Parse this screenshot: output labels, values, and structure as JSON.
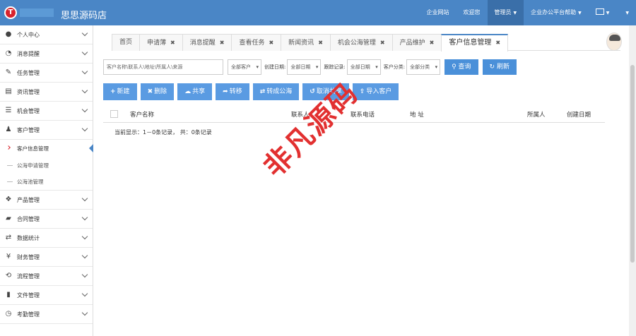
{
  "app": {
    "logo_letter": "T",
    "title": "思思源码店"
  },
  "topnav": {
    "items": [
      "企业网站",
      "欢迎您",
      "管理员",
      "企业办公平台帮助"
    ],
    "active_index": 2
  },
  "sidebar": {
    "items": [
      {
        "label": "个人中心",
        "icon": "user-icon"
      },
      {
        "label": "消息提醒",
        "icon": "bell-icon"
      },
      {
        "label": "任务管理",
        "icon": "edit-icon"
      },
      {
        "label": "资讯管理",
        "icon": "document-icon"
      },
      {
        "label": "机会管理",
        "icon": "list-icon"
      },
      {
        "label": "客户管理",
        "icon": "users-icon"
      },
      {
        "label": "产品管理",
        "icon": "box-icon"
      },
      {
        "label": "合同管理",
        "icon": "folder-icon"
      },
      {
        "label": "数据统计",
        "icon": "shuffle-icon"
      },
      {
        "label": "财务管理",
        "icon": "yen-icon"
      },
      {
        "label": "流程管理",
        "icon": "retweet-icon"
      },
      {
        "label": "文件管理",
        "icon": "file-icon"
      },
      {
        "label": "考勤管理",
        "icon": "clock-icon"
      }
    ],
    "subitems": [
      "客户信息管理",
      "公海申请管理",
      "公海池管理"
    ],
    "active_sub": "客户信息管理"
  },
  "tabs": [
    {
      "label": "首页",
      "closable": false
    },
    {
      "label": "申请薄",
      "closable": true
    },
    {
      "label": "消息提醒",
      "closable": true
    },
    {
      "label": "查看任务",
      "closable": true
    },
    {
      "label": "新闻资讯",
      "closable": true
    },
    {
      "label": "机会公海管理",
      "closable": true
    },
    {
      "label": "产品维护",
      "closable": true
    },
    {
      "label": "客户信息管理",
      "closable": true,
      "active": true
    }
  ],
  "filters": {
    "search_placeholder": "客户名称\\联系人\\地址\\所属人\\来源",
    "customer_select": "全部客户",
    "create_date_label": "创建日期:",
    "create_date_select": "全部日期",
    "followup_label": "跟踪记录:",
    "followup_select": "全部日期",
    "category_label": "客户分类:",
    "category_select": "全部分类",
    "query_label": "查询",
    "refresh_label": "刷新"
  },
  "toolbar": {
    "new": "新建",
    "delete": "删除",
    "share": "共享",
    "transfer": "转移",
    "to_public": "转成公海",
    "cancel_share": "取消共享",
    "import": "导入客户"
  },
  "table": {
    "columns": [
      "客户名称",
      "联系人",
      "联系电话",
      "地 址",
      "所属人",
      "创建日期"
    ],
    "record_info": "当前显示：1－0条记录， 共：0条记录"
  },
  "watermark": "非凡源码",
  "colors": {
    "header": "#4a86c6",
    "button": "#5a9be2",
    "watermark": "#e23030"
  }
}
